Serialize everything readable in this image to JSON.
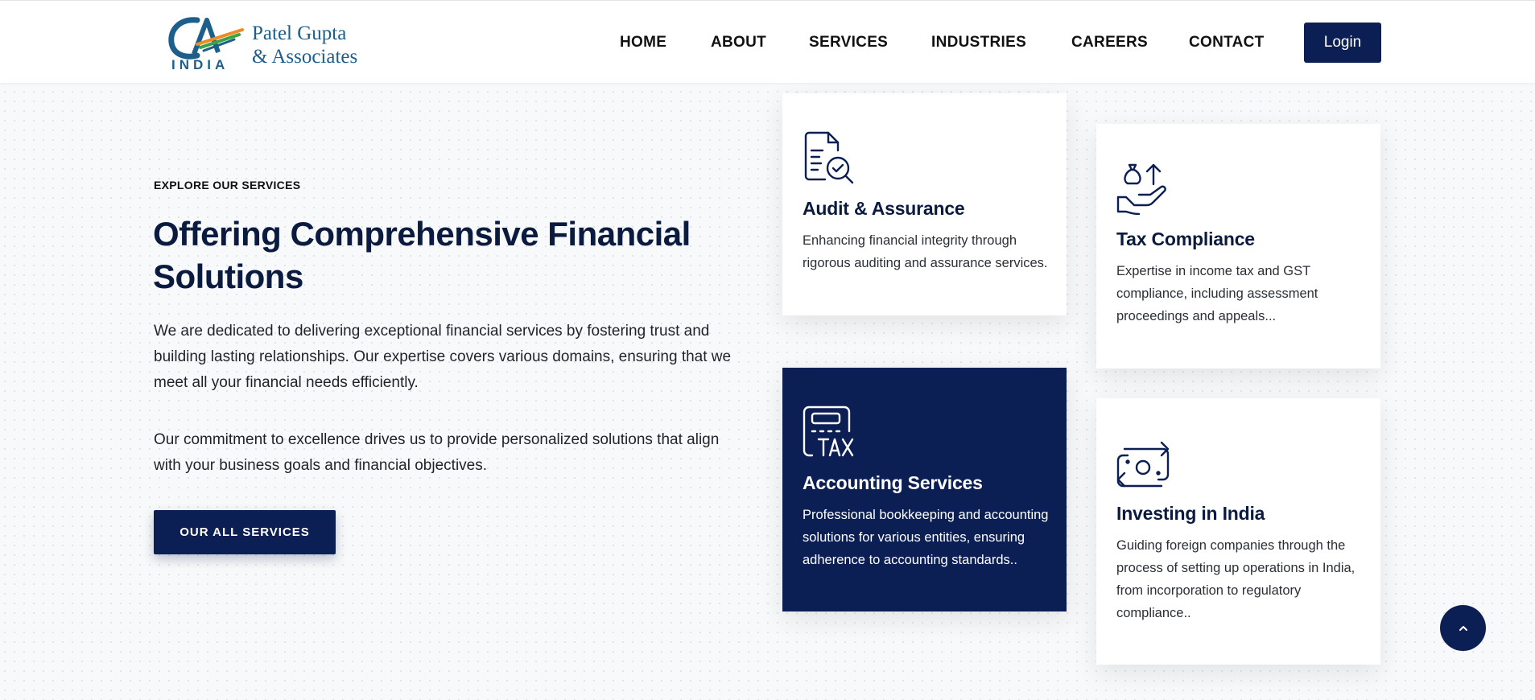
{
  "header": {
    "logo": {
      "line1": "Patel Gupta",
      "line2": "& Associates",
      "badge": "INDIA",
      "mark_text": "CA"
    },
    "nav": [
      "HOME",
      "ABOUT",
      "SERVICES",
      "INDUSTRIES",
      "CAREERS",
      "CONTACT"
    ],
    "login_label": "Login"
  },
  "intro": {
    "eyebrow": "EXPLORE OUR SERVICES",
    "headline": "Offering Comprehensive Financial Solutions",
    "paragraph1": "We are dedicated to delivering exceptional financial services by fostering trust and building lasting relationships. Our expertise covers various domains, ensuring that we meet all your financial needs efficiently.",
    "paragraph2": "Our commitment to excellence drives us to provide personalized solutions that align with your business goals and financial objectives.",
    "button_label": "OUR ALL SERVICES"
  },
  "services": [
    {
      "title": "Audit & Assurance",
      "description": "Enhancing financial integrity through rigorous auditing and assurance services.",
      "icon": "audit-document-check-icon"
    },
    {
      "title": "Tax Compliance",
      "description": "Expertise in income tax and GST compliance, including assessment proceedings and appeals...",
      "icon": "money-bag-hand-icon"
    },
    {
      "title": "Accounting Services",
      "description": "Professional bookkeeping and accounting solutions for various entities, ensuring adherence to accounting standards..",
      "icon": "tax-calculator-icon",
      "icon_text": "TAX"
    },
    {
      "title": "Investing in India",
      "description": "Guiding foreign companies through the process of setting up operations in India, from incorporation to regulatory compliance..",
      "icon": "money-exchange-icon"
    }
  ],
  "scroll_top_icon": "chevron-up-icon",
  "colors": {
    "primary": "#0c1f55",
    "logo_blue": "#1d5f8a",
    "logo_orange": "#f08a24",
    "logo_green": "#3aa34a",
    "background": "#f8f9fa"
  }
}
